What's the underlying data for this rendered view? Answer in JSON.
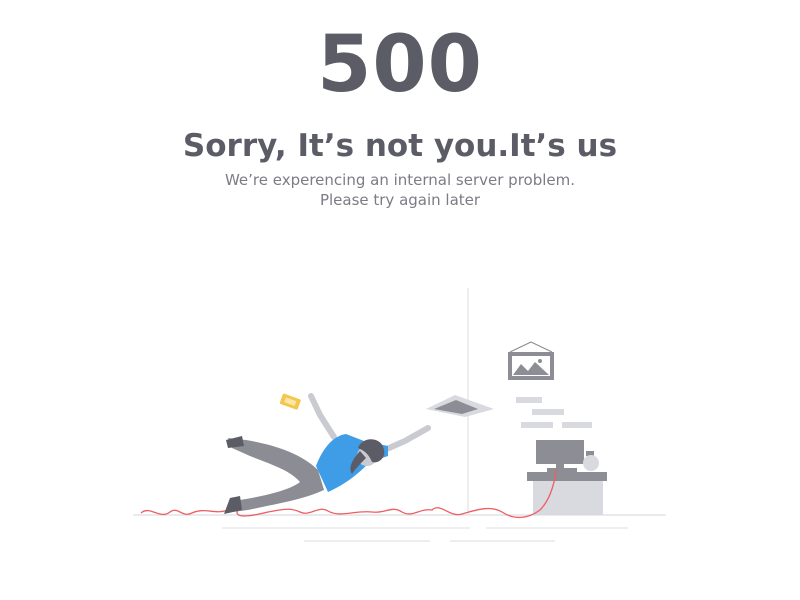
{
  "error": {
    "code": "500",
    "headline": "Sorry, It’s not you.It’s us",
    "message_line1": "We’re experencing an internal server problem.",
    "message_line2": "Please try again later"
  },
  "colors": {
    "heading": "#5b5c66",
    "body_text": "#7b7c85",
    "shirt": "#3f9de8",
    "pants": "#8c8d94",
    "skin": "#c9cbd1",
    "cable": "#ee5d62",
    "furniture": "#d9dadf",
    "furniture_dark": "#8d8e95",
    "phone": "#f3c64e",
    "floor": "#e2e3e7"
  },
  "illustration": {
    "icons": [
      "falling-person-icon",
      "phone-icon",
      "paper-icon",
      "picture-frame-icon",
      "desk-icon",
      "computer-monitor-icon",
      "vase-icon",
      "power-cable-icon"
    ]
  }
}
